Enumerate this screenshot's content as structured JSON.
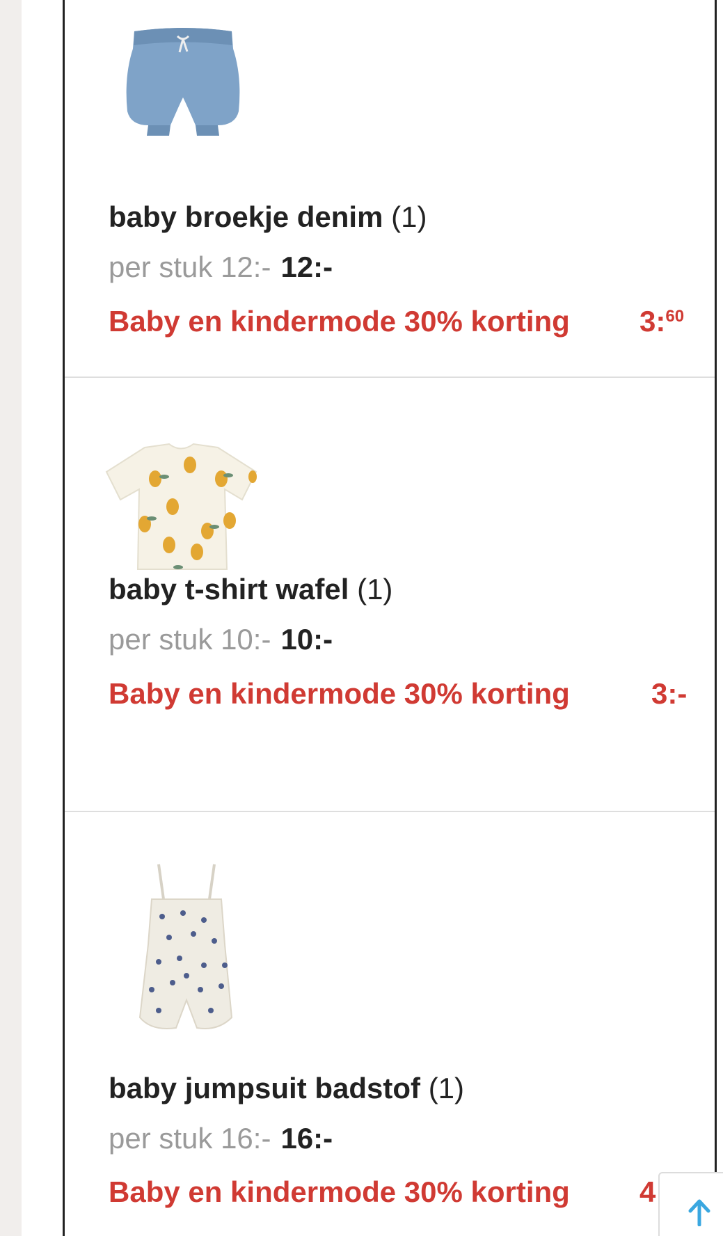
{
  "items": [
    {
      "name": "baby broekje denim",
      "qty": "(1)",
      "unit_label": "per stuk 12:-",
      "total": "12:-",
      "discount_label": "Baby en kindermode 30% korting",
      "discount_whole": "3:",
      "discount_cents": "60",
      "image": "denim-bloomer-shorts"
    },
    {
      "name": "baby t-shirt wafel",
      "qty": "(1)",
      "unit_label": "per stuk 10:-",
      "total": "10:-",
      "discount_label": "Baby en kindermode 30% korting",
      "discount_amount": "3:-",
      "image": "pear-print-tshirt"
    },
    {
      "name": "baby jumpsuit badstof",
      "qty": "(1)",
      "unit_label": "per stuk 16:-",
      "total": "16:-",
      "discount_label": "Baby en kindermode 30% korting",
      "discount_amount": "4",
      "image": "floral-terry-jumpsuit"
    }
  ],
  "scroll_top_icon": "arrow-up-icon",
  "colors": {
    "discount": "#d03a33",
    "text": "#222222",
    "muted": "#9a9a9a",
    "scroll_arrow": "#3aa7e0"
  }
}
